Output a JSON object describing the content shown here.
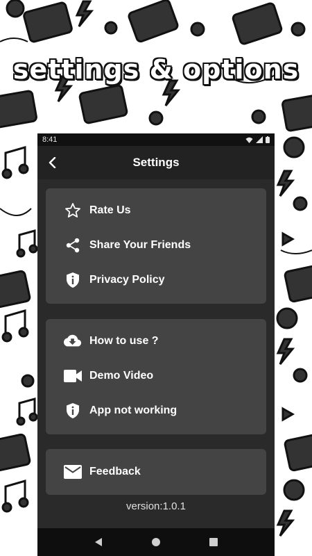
{
  "promo": {
    "title": "settings & options"
  },
  "status_bar": {
    "time": "8:41"
  },
  "app_bar": {
    "title": "Settings"
  },
  "cards": [
    {
      "items": [
        {
          "label": "Rate Us",
          "icon": "star-outline-icon"
        },
        {
          "label": "Share Your Friends",
          "icon": "share-icon"
        },
        {
          "label": "Privacy Policy",
          "icon": "info-shield-icon"
        }
      ]
    },
    {
      "items": [
        {
          "label": "How to use ?",
          "icon": "cloud-download-icon"
        },
        {
          "label": "Demo Video",
          "icon": "video-camera-icon"
        },
        {
          "label": "App not working",
          "icon": "info-shield-icon"
        }
      ]
    },
    {
      "items": [
        {
          "label": "Feedback",
          "icon": "mail-icon"
        }
      ]
    }
  ],
  "version": "version:1.0.1",
  "colors": {
    "screen_bg": "#2a2a2a",
    "card_bg": "#444444",
    "appbar_bg": "#222222",
    "text": "#ffffff"
  }
}
